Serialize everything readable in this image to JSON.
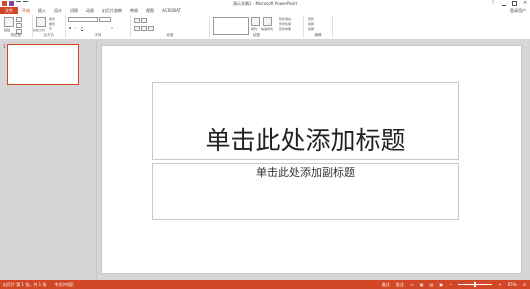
{
  "window": {
    "title": "演示文稿1 - Microsoft PowerPoint",
    "account": "登录用户"
  },
  "tabs": [
    "文件",
    "开始",
    "插入",
    "设计",
    "切换",
    "动画",
    "幻灯片放映",
    "审阅",
    "视图",
    "ACROBAT"
  ],
  "ribbon": {
    "groups": [
      "剪贴板",
      "幻灯片",
      "字体",
      "段落",
      "绘图",
      "编辑"
    ],
    "items": {
      "paste": "粘贴",
      "new_slide": "新建幻灯片",
      "layout": "版式",
      "reset": "重置",
      "section": "节",
      "shape_fill": "形状填充",
      "shape_outline": "形状轮廓",
      "shape_effects": "形状效果",
      "arrange": "排列",
      "quick_styles": "快速样式",
      "find": "查找",
      "replace": "替换",
      "select": "选择"
    }
  },
  "thumbnails": {
    "slide_number": "1"
  },
  "slide": {
    "title_placeholder": "单击此处添加标题",
    "subtitle_placeholder": "单击此处添加副标题"
  },
  "status": {
    "slide_info": "幻灯片 第 1 张，共 1 张",
    "language": "中文(中国)",
    "notes": "备注",
    "comments": "批注",
    "zoom": "65%"
  },
  "colors": {
    "accent": "#d24726",
    "canvas": "#d6d6d6"
  }
}
